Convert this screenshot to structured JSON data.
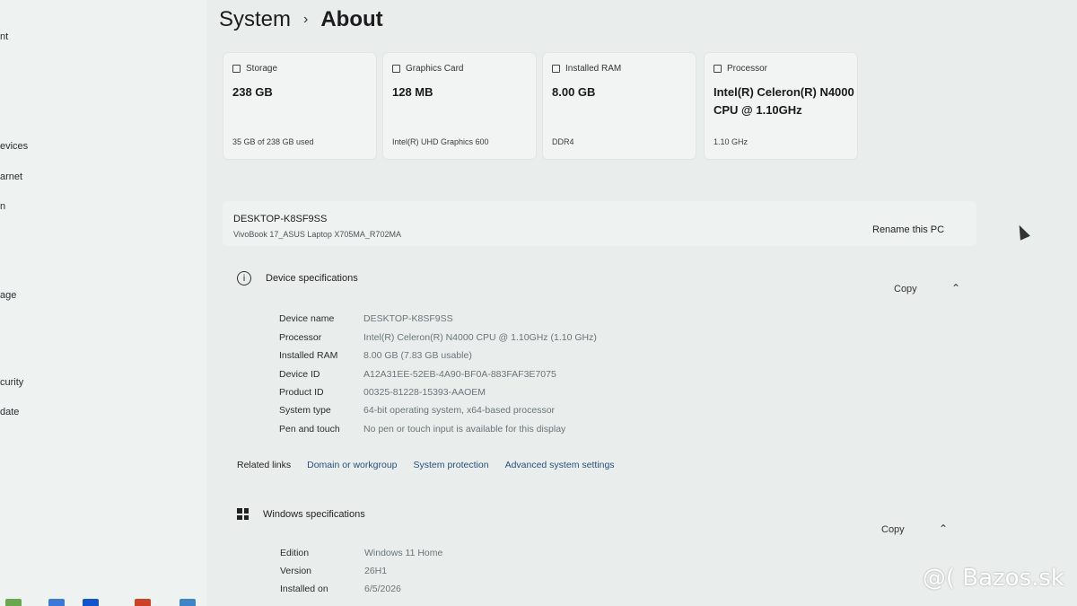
{
  "sidebar": {
    "items": [
      {
        "label": "nt"
      },
      {
        "label": "evices"
      },
      {
        "label": "arnet"
      },
      {
        "label": "n"
      },
      {
        "label": "age"
      },
      {
        "label": "curity"
      },
      {
        "label": "date"
      }
    ]
  },
  "header": {
    "parent": "System",
    "separator": "›",
    "current": "About"
  },
  "cards": [
    {
      "title": "Storage",
      "value": "238 GB",
      "sub": "35 GB of 238 GB used",
      "icon": "storage-icon"
    },
    {
      "title": "Graphics Card",
      "value": "128 MB",
      "sub": "Intel(R) UHD Graphics 600",
      "icon": "graphics-card-icon"
    },
    {
      "title": "Installed RAM",
      "value": "8.00 GB",
      "sub": "DDR4",
      "icon": "ram-icon"
    },
    {
      "title": "Processor",
      "value": "Intel(R) Celeron(R) N4000 CPU @ 1.10GHz",
      "sub": "1.10 GHz",
      "icon": "processor-icon"
    }
  ],
  "pc": {
    "name": "DESKTOP-K8SF9SS",
    "model": "VivoBook 17_ASUS Laptop X705MA_R702MA",
    "rename_label": "Rename this PC"
  },
  "device_specs": {
    "title": "Device specifications",
    "copy_label": "Copy",
    "rows": [
      {
        "label": "Device name",
        "value": "DESKTOP-K8SF9SS"
      },
      {
        "label": "Processor",
        "value": "Intel(R) Celeron(R) N4000 CPU @ 1.10GHz (1.10 GHz)"
      },
      {
        "label": "Installed RAM",
        "value": "8.00 GB (7.83 GB usable)"
      },
      {
        "label": "Device ID",
        "value": "A12A31EE-52EB-4A90-BF0A-883FAF3E7075"
      },
      {
        "label": "Product ID",
        "value": "00325-81228-15393-AAOEM"
      },
      {
        "label": "System type",
        "value": "64-bit operating system, x64-based processor"
      },
      {
        "label": "Pen and touch",
        "value": "No pen or touch input is available for this display"
      }
    ]
  },
  "related": {
    "label": "Related links",
    "links": [
      "Domain or workgroup",
      "System protection",
      "Advanced system settings"
    ]
  },
  "windows_specs": {
    "title": "Windows specifications",
    "copy_label": "Copy",
    "rows": [
      {
        "label": "Edition",
        "value": "Windows 11 Home"
      },
      {
        "label": "Version",
        "value": "26H1"
      },
      {
        "label": "Installed on",
        "value": "6/5/2026"
      }
    ]
  },
  "watermark": "@( Bazos.sk"
}
